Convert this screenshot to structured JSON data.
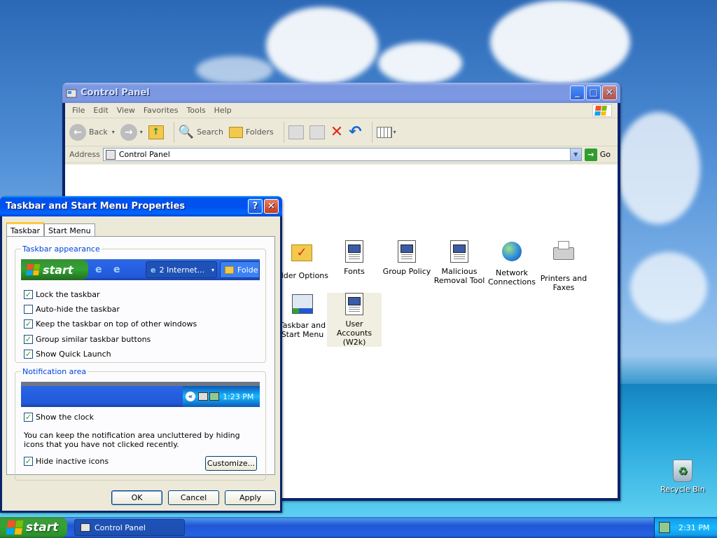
{
  "control_panel": {
    "title": "Control Panel",
    "menu": [
      "File",
      "Edit",
      "View",
      "Favorites",
      "Tools",
      "Help"
    ],
    "toolbar": {
      "back": "Back",
      "search": "Search",
      "folders": "Folders"
    },
    "address": {
      "label": "Address",
      "value": "Control Panel",
      "go": "Go"
    },
    "items": [
      {
        "label": "older Options"
      },
      {
        "label": "Fonts"
      },
      {
        "label": "Group Policy"
      },
      {
        "label": "Malicious Removal Tool"
      },
      {
        "label": "Network Connections"
      },
      {
        "label": "Printers and Faxes"
      },
      {
        "label": "Taskbar and Start Menu"
      },
      {
        "label": "User Accounts (W2k)"
      }
    ]
  },
  "dialog": {
    "title": "Taskbar and Start Menu Properties",
    "tabs": [
      "Taskbar",
      "Start Menu"
    ],
    "appearance": {
      "label": "Taskbar appearance",
      "preview": {
        "start": "start",
        "task1": "2 Internet...",
        "task2": "Folde"
      },
      "options": [
        {
          "label": "Lock the taskbar",
          "checked": true
        },
        {
          "label": "Auto-hide the taskbar",
          "checked": false
        },
        {
          "label": "Keep the taskbar on top of other windows",
          "checked": true
        },
        {
          "label": "Group similar taskbar buttons",
          "checked": true
        },
        {
          "label": "Show Quick Launch",
          "checked": true
        }
      ]
    },
    "notification": {
      "label": "Notification area",
      "preview_time": "1:23 PM",
      "show_clock": "Show the clock",
      "description": "You can keep the notification area uncluttered by hiding icons that you have not clicked recently.",
      "hide_inactive": "Hide inactive icons",
      "customize": "Customize..."
    },
    "buttons": {
      "ok": "OK",
      "cancel": "Cancel",
      "apply": "Apply"
    }
  },
  "desktop": {
    "recycle_bin": "Recycle Bin"
  },
  "taskbar": {
    "start": "start",
    "item": "Control Panel",
    "clock": "2:31 PM"
  },
  "colors": {
    "xp_blue": "#0053ee",
    "start_green": "#32a332",
    "accent_group": "#0046d5"
  }
}
